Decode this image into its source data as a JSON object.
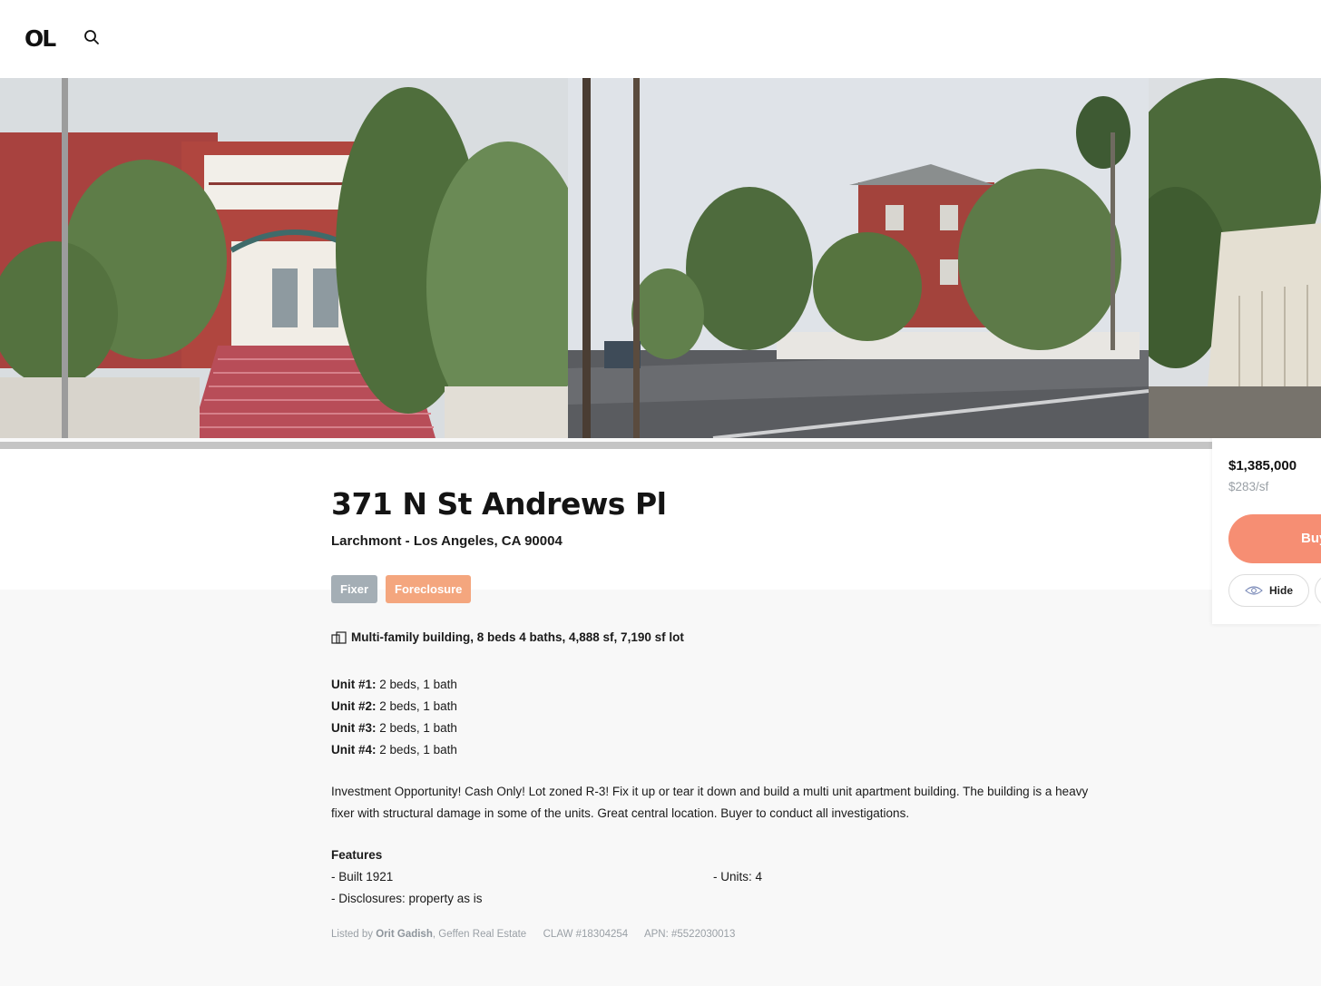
{
  "header": {
    "logo": "OL",
    "search_icon": "search-icon"
  },
  "listing": {
    "address": "371 N St Andrews Pl",
    "location": "Larchmont - Los Angeles, CA 90004",
    "tags": [
      "Fixer",
      "Foreclosure"
    ],
    "summary": "Multi-family building, 8 beds 4 baths, 4,888 sf, 7,190 sf lot",
    "units": [
      {
        "label": "Unit #1:",
        "value": "2 beds, 1 bath"
      },
      {
        "label": "Unit #2:",
        "value": "2 beds, 1 bath"
      },
      {
        "label": "Unit #3:",
        "value": "2 beds, 1 bath"
      },
      {
        "label": "Unit #4:",
        "value": "2 beds, 1 bath"
      }
    ],
    "description": "Investment Opportunity! Cash Only! Lot zoned R-3! Fix it up or tear it down and build a multi unit apartment building. The building is a heavy fixer with structural damage in some of the units. Great central location. Buyer to conduct all investigations.",
    "features_title": "Features",
    "features": [
      "- Built 1921",
      "- Units: 4",
      "- Disclosures: property as is"
    ],
    "listed_prefix": "Listed by",
    "agent": "Orit Gadish",
    "brokerage": ", Geffen Real Estate",
    "claw": "CLAW #18304254",
    "apn": "APN: #5522030013"
  },
  "sidebar": {
    "price": "$1,385,000",
    "price_per_sf": "$283/sf",
    "buy_label": "Buy",
    "hide_label": "Hide"
  },
  "colors": {
    "accent": "#f68e73",
    "tag_fixer": "#a4aeb5",
    "tag_foreclosure": "#f4a67e"
  }
}
